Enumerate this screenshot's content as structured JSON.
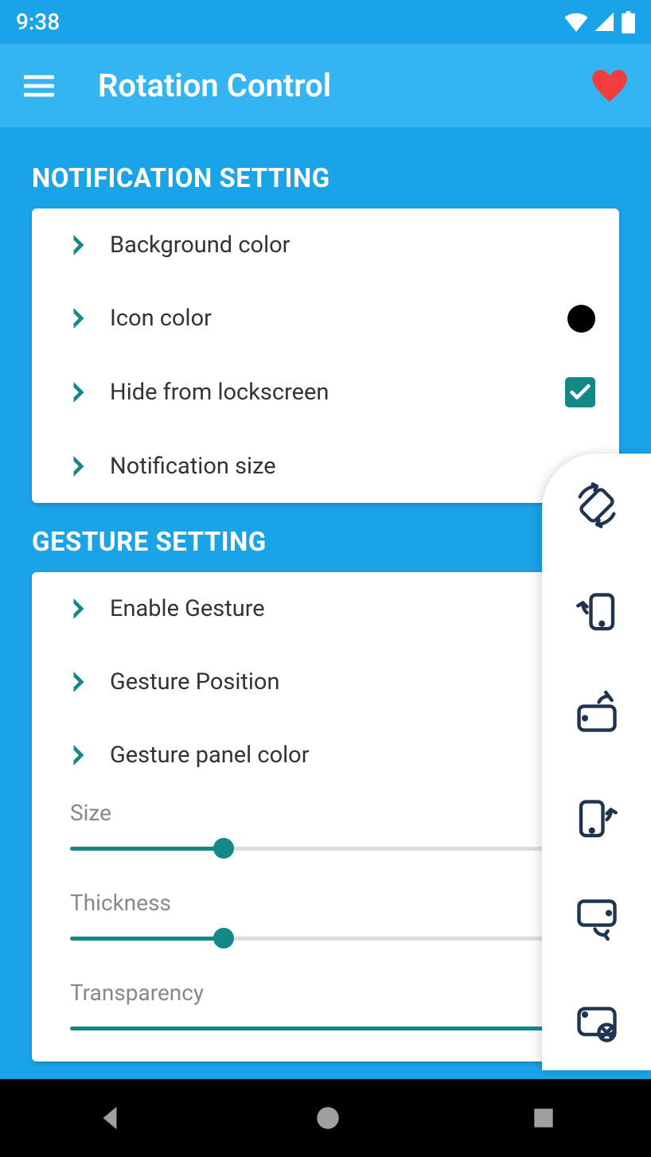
{
  "status": {
    "time": "9:38"
  },
  "appBar": {
    "title": "Rotation Control"
  },
  "sections": {
    "notification": {
      "title": "NOTIFICATION SETTING",
      "items": {
        "bgcolor": "Background color",
        "iconcolor": "Icon color",
        "hidelock": "Hide from lockscreen",
        "notifsize": "Notification size"
      },
      "iconColorValue": "#000000",
      "hideLockscreenChecked": true
    },
    "gesture": {
      "title": "GESTURE SETTING",
      "items": {
        "enable": "Enable Gesture",
        "position": "Gesture Position",
        "panelcolor": "Gesture panel color"
      },
      "sliders": {
        "size": {
          "label": "Size",
          "value": 30
        },
        "thickness": {
          "label": "Thickness",
          "value": 30
        },
        "transparency": {
          "label": "Transparency",
          "value": 100
        }
      }
    }
  },
  "sideIcons": [
    "auto-rotate",
    "rotate-left",
    "landscape-up",
    "rotate-right",
    "landscape-down",
    "lock-rotation"
  ],
  "colors": {
    "primary": "#1ba3e8",
    "accent": "#148888"
  }
}
